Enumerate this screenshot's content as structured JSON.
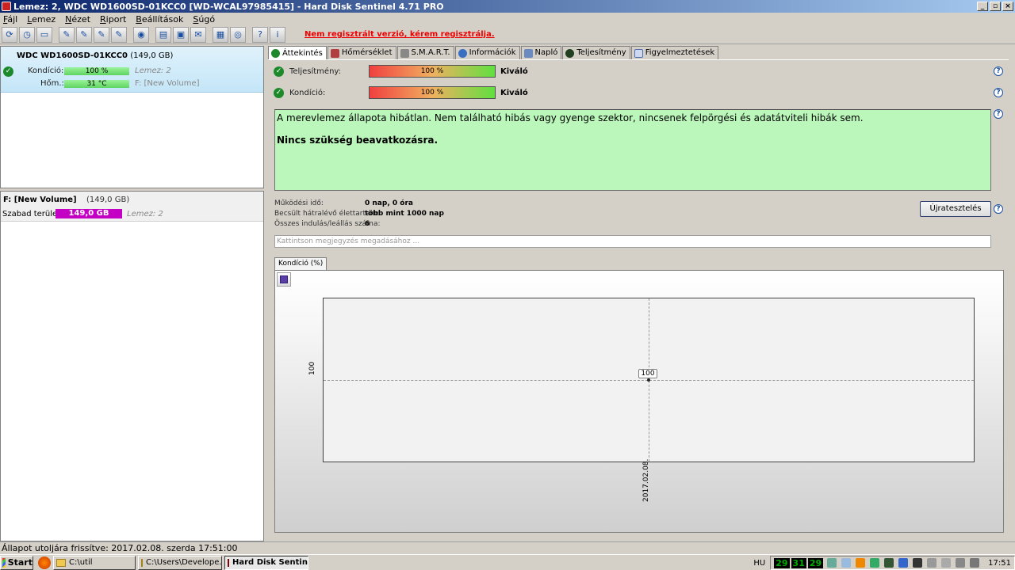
{
  "window": {
    "title": "Lemez: 2, WDC WD1600SD-01KCC0 [WD-WCAL97985415]  -  Hard Disk Sentinel 4.71 PRO"
  },
  "menu": [
    "Fájl",
    "Lemez",
    "Nézet",
    "Riport",
    "Beállítások",
    "Súgó"
  ],
  "toolbar": {
    "registration_notice": "Nem regisztrált verzió, kérem regisztrálja."
  },
  "disk": {
    "name": "WDC WD1600SD-01KCC0",
    "size": "(149,0 GB)",
    "condition_label": "Kondíció:",
    "condition_value": "100 %",
    "disk_number": "Lemez: 2",
    "temp_label": "Hőm.:",
    "temp_value": "31 °C",
    "volume_ref": "F: [New Volume]"
  },
  "volume": {
    "title": "F: [New Volume]",
    "size": "(149,0 GB)",
    "free_label": "Szabad terület",
    "free_value": "149,0 GB",
    "disk_number": "Lemez: 2"
  },
  "tabs": [
    "Áttekintés",
    "Hőmérséklet",
    "S.M.A.R.T.",
    "Információk",
    "Napló",
    "Teljesítmény",
    "Figyelmeztetések"
  ],
  "overview": {
    "performance_label": "Teljesítmény:",
    "performance_value": "100 %",
    "performance_status": "Kiváló",
    "condition_label": "Kondíció:",
    "condition_value": "100 %",
    "condition_status": "Kiváló",
    "status_text": "A merevlemez állapota hibátlan. Nem található hibás vagy gyenge szektor, nincsenek felpörgési és adatátviteli hibák sem.",
    "status_action": "Nincs szükség beavatkozásra.",
    "uptime_label": "Működési idő:",
    "uptime_value": "0 nap, 0 óra",
    "lifetime_label": "Becsült hátralévő élettartam:",
    "lifetime_value": "több mint 1000 nap",
    "startstop_label": "Összes indulás/leállás száma:",
    "startstop_value": "6",
    "retest_button": "Újratesztelés",
    "note_placeholder": "Kattintson megjegyzés megadásához ..."
  },
  "chart_data": {
    "type": "line",
    "tab_label": "Kondíció  (%)",
    "x": [
      "2017.02.08."
    ],
    "series": [
      {
        "name": "Kondíció",
        "values": [
          100
        ]
      }
    ],
    "point_label": "100",
    "y_tick": "100",
    "x_tick": "2017.02.08."
  },
  "statusbar": {
    "text": "Állapot utoljára frissítve: 2017.02.08. szerda 17:51:00"
  },
  "taskbar": {
    "start": "Start",
    "tasks": [
      "C:\\util",
      "C:\\Users\\Develope...",
      "Hard Disk Sentinel"
    ],
    "lang": "HU",
    "temps": [
      "29",
      "31",
      "29"
    ],
    "clock": "17:51"
  }
}
